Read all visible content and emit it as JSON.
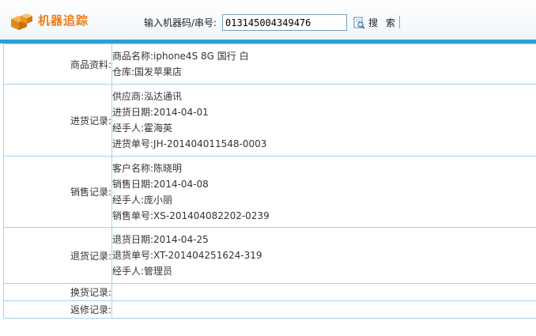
{
  "header": {
    "title": "机器追踪",
    "search_label": "输入机器码/串号:",
    "search_value": "013145004349476",
    "search_button": "搜 索"
  },
  "sections": {
    "product": {
      "label": "商品资料:",
      "lines": [
        {
          "k": "商品名称:",
          "v": "iphone4S 8G 国行 白"
        },
        {
          "k": "仓库:",
          "v": "国发苹果店"
        }
      ]
    },
    "purchase": {
      "label": "进货记录:",
      "lines": [
        {
          "k": "供应商:",
          "v": "泓达通讯"
        },
        {
          "k": "进货日期:",
          "v": "2014-04-01"
        },
        {
          "k": "经手人:",
          "v": "霍海英"
        },
        {
          "k": "进货单号:",
          "v": "JH-201404011548-0003"
        }
      ]
    },
    "sales": {
      "label": "销售记录:",
      "lines": [
        {
          "k": "客户名称:",
          "v": "陈晓明"
        },
        {
          "k": "销售日期:",
          "v": "2014-04-08"
        },
        {
          "k": "经手人:",
          "v": "庞小丽"
        },
        {
          "k": "销售单号:",
          "v": "XS-201404082202-0239"
        }
      ]
    },
    "returns": {
      "label": "退货记录:",
      "lines": [
        {
          "k": "退货日期:",
          "v": "2014-04-25"
        },
        {
          "k": "退货单号:",
          "v": "XT-201404251624-319"
        },
        {
          "k": "经手人:",
          "v": "管理员"
        }
      ]
    },
    "exchange": {
      "label": "换货记录:"
    },
    "repair": {
      "label": "返修记录:"
    }
  },
  "colors": {
    "title": "#f07d16",
    "accent_bar": "#2d9fd8",
    "border": "#a7d3ea"
  },
  "icons": {
    "logo": "boxes-icon",
    "search": "document-search-icon"
  }
}
